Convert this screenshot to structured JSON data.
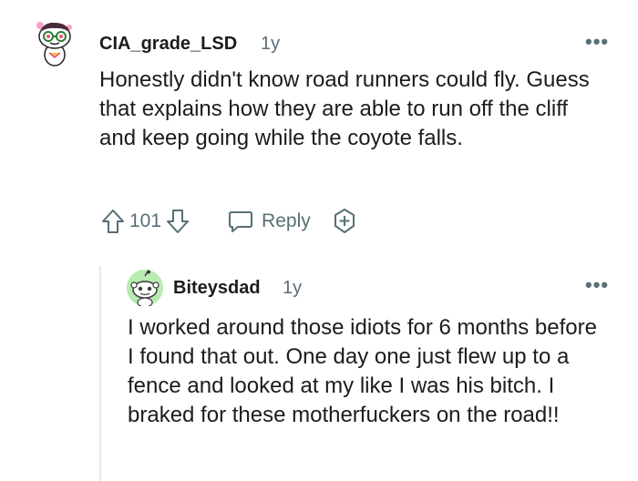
{
  "comments": [
    {
      "username": "CIA_grade_LSD",
      "age": "1y",
      "body": "Honestly didn't know road runners could fly. Guess that explains how they are able to run off the cliff and keep going while the coyote falls.",
      "vote_count": "101",
      "reply_label": "Reply",
      "more_label": "•••"
    },
    {
      "username": "Biteysdad",
      "age": "1y",
      "body": "I worked around those idiots for 6 months before I found that out. One day one just flew up to a fence and looked at my like I was his bitch. I braked for these motherfuckers on the road!!",
      "more_label": "•••"
    }
  ],
  "icons": {
    "upvote": "upvote-arrow-icon",
    "downvote": "downvote-arrow-icon",
    "reply": "reply-bubble-icon",
    "award": "award-plus-icon",
    "more": "more-options-icon"
  },
  "colors": {
    "text": "#1c1c1c",
    "meta": "#576f76",
    "thread": "#e5ebee"
  }
}
